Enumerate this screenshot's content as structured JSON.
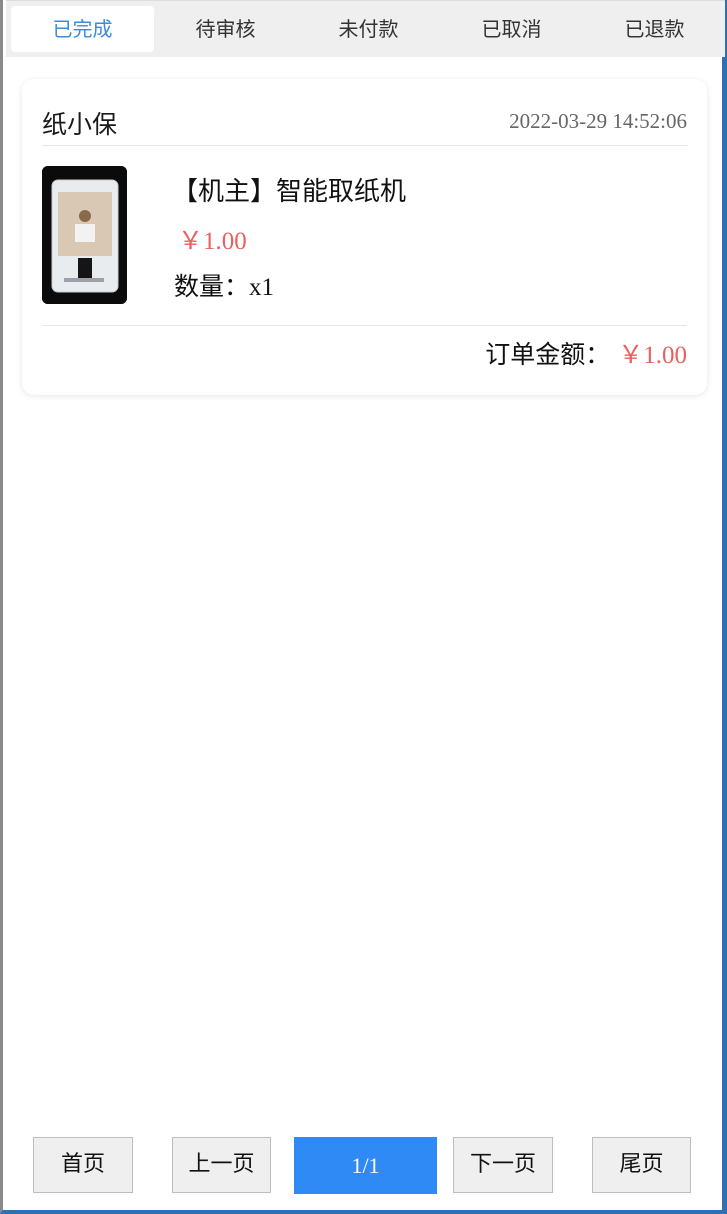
{
  "tabs": [
    {
      "label": "已完成",
      "active": true
    },
    {
      "label": "待审核",
      "active": false
    },
    {
      "label": "未付款",
      "active": false
    },
    {
      "label": "已取消",
      "active": false
    },
    {
      "label": "已退款",
      "active": false
    }
  ],
  "order": {
    "shop_name": "纸小保",
    "time": "2022-03-29 14:52:06",
    "product_name": "【机主】智能取纸机",
    "price": "￥1.00",
    "qty_label": "数量：",
    "qty_value": "x1",
    "total_label": "订单金额：",
    "total_value": "￥1.00"
  },
  "pager": {
    "first": "首页",
    "prev": "上一页",
    "current": "1/1",
    "next": "下一页",
    "last": "尾页"
  },
  "colors": {
    "accent_blue": "#3d8bdb",
    "price_red": "#e86060",
    "pager_active": "#2f8af5"
  }
}
